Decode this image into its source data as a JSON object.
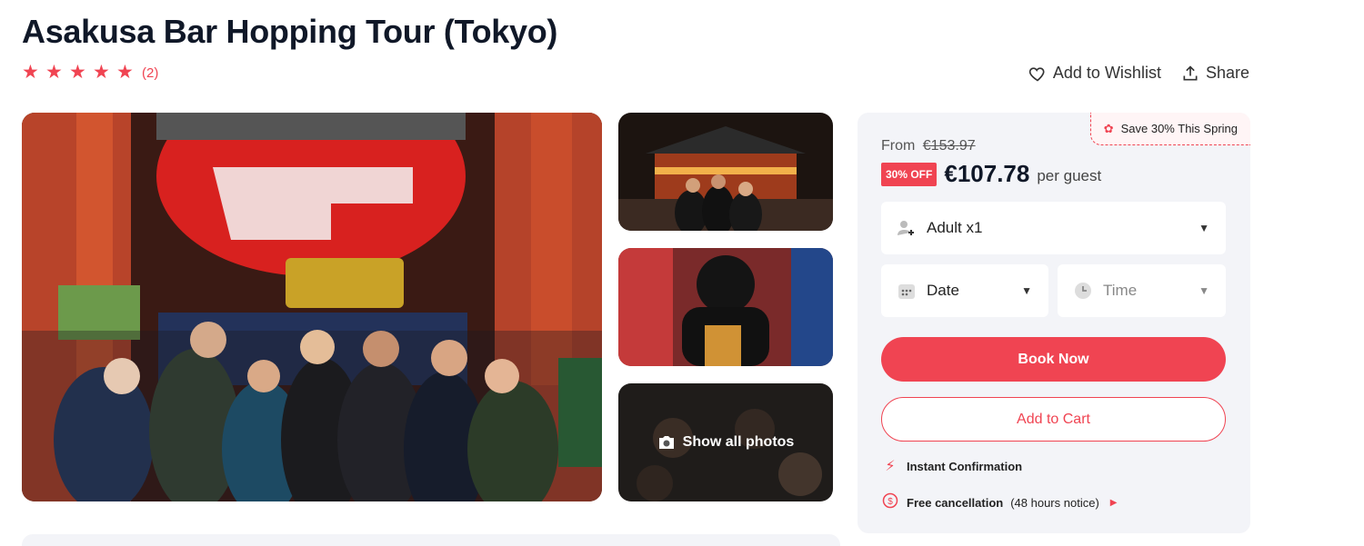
{
  "page": {
    "title": "Asakusa Bar Hopping Tour (Tokyo)",
    "rating_count": "(2)",
    "rating_value": 5,
    "wishlist_label": "Add to Wishlist",
    "share_label": "Share"
  },
  "gallery": {
    "show_all_label": "Show all photos"
  },
  "booking": {
    "promo": "Save 30% This Spring",
    "from_label": "From",
    "old_price": "€153.97",
    "discount_badge": "30% OFF",
    "price": "€107.78",
    "per_label": "per guest",
    "guests_value": "Adult x1",
    "date_value": "Date",
    "time_value": "Time",
    "book_label": "Book Now",
    "cart_label": "Add to Cart",
    "instant_label": "Instant Confirmation",
    "cancel_label": "Free cancellation",
    "cancel_note": "(48 hours notice)"
  },
  "colors": {
    "accent": "#f04452",
    "panel": "#f3f4f8",
    "title": "#101828"
  },
  "icons": [
    "star-icon",
    "heart-icon",
    "share-icon",
    "camera-icon",
    "guest-add-icon",
    "calendar-icon",
    "clock-icon",
    "chevron-down-icon",
    "lightning-icon",
    "refund-icon",
    "flower-icon"
  ]
}
